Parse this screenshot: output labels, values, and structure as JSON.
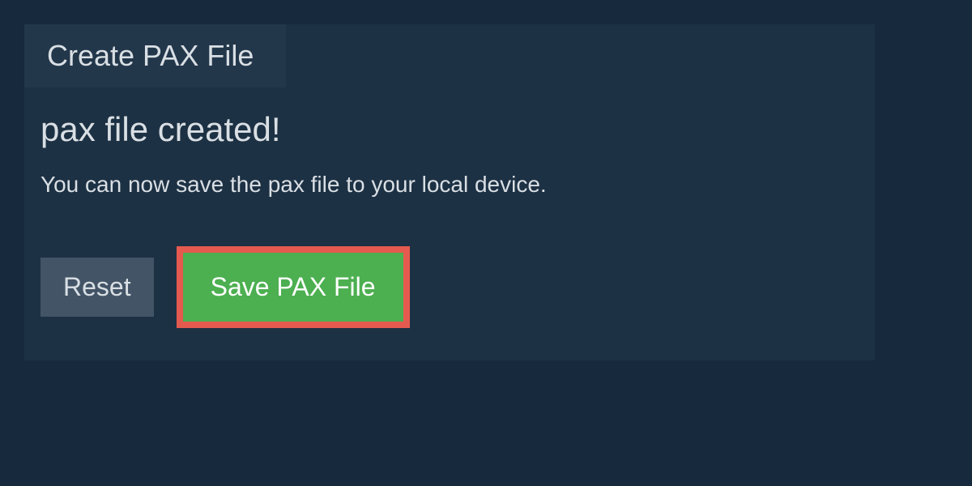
{
  "tab": {
    "title": "Create PAX File"
  },
  "status": {
    "title": "pax file created!",
    "message": "You can now save the pax file to your local device."
  },
  "buttons": {
    "reset_label": "Reset",
    "save_label": "Save PAX File"
  }
}
